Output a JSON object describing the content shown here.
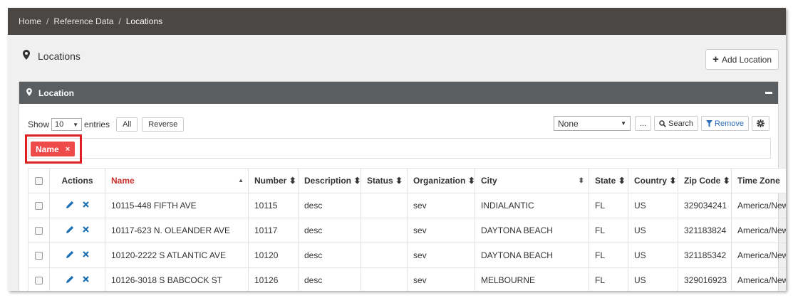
{
  "breadcrumb": {
    "home": "Home",
    "section": "Reference Data",
    "current": "Locations",
    "separator": "/"
  },
  "page": {
    "title": "Locations",
    "add_label": "Add Location",
    "add_plus": "+"
  },
  "panel": {
    "title": "Location"
  },
  "controls": {
    "show_label": "Show",
    "page_length": "10",
    "entries_label": "entries",
    "all_label": "All",
    "reverse_label": "Reverse",
    "filter_select": "None",
    "ellipsis_label": "...",
    "search_label": "Search",
    "remove_label": "Remove"
  },
  "filter_chip": {
    "label": "Name",
    "remove": "×"
  },
  "table": {
    "headers": [
      "Actions",
      "Name",
      "Number",
      "Description",
      "Status",
      "Organization",
      "City",
      "State",
      "Country",
      "Zip Code",
      "Time Zone"
    ],
    "rows": [
      {
        "name": "10115-448 FIFTH AVE",
        "number": "10115",
        "description": "desc",
        "status": "",
        "organization": "sev",
        "city": "INDIALANTIC",
        "state": "FL",
        "country": "US",
        "zip": "329034241",
        "tz": "America/New_York"
      },
      {
        "name": "10117-623 N. OLEANDER AVE",
        "number": "10117",
        "description": "desc",
        "status": "",
        "organization": "sev",
        "city": "DAYTONA BEACH",
        "state": "FL",
        "country": "US",
        "zip": "321183824",
        "tz": "America/New_York"
      },
      {
        "name": "10120-2222 S ATLANTIC AVE",
        "number": "10120",
        "description": "desc",
        "status": "",
        "organization": "sev",
        "city": "DAYTONA BEACH",
        "state": "FL",
        "country": "US",
        "zip": "321185342",
        "tz": "America/New_York"
      },
      {
        "name": "10126-3018 S BABCOCK ST",
        "number": "10126",
        "description": "desc",
        "status": "",
        "organization": "sev",
        "city": "MELBOURNE",
        "state": "FL",
        "country": "US",
        "zip": "329016923",
        "tz": "America/New_York"
      }
    ]
  },
  "colors": {
    "topbar": "#4a4744",
    "panel_header": "#5a5e60",
    "chip": "#ef4a4a",
    "highlight": "#e02020",
    "sorted_header": "#c9302c",
    "action_icon": "#1a6fb5"
  }
}
